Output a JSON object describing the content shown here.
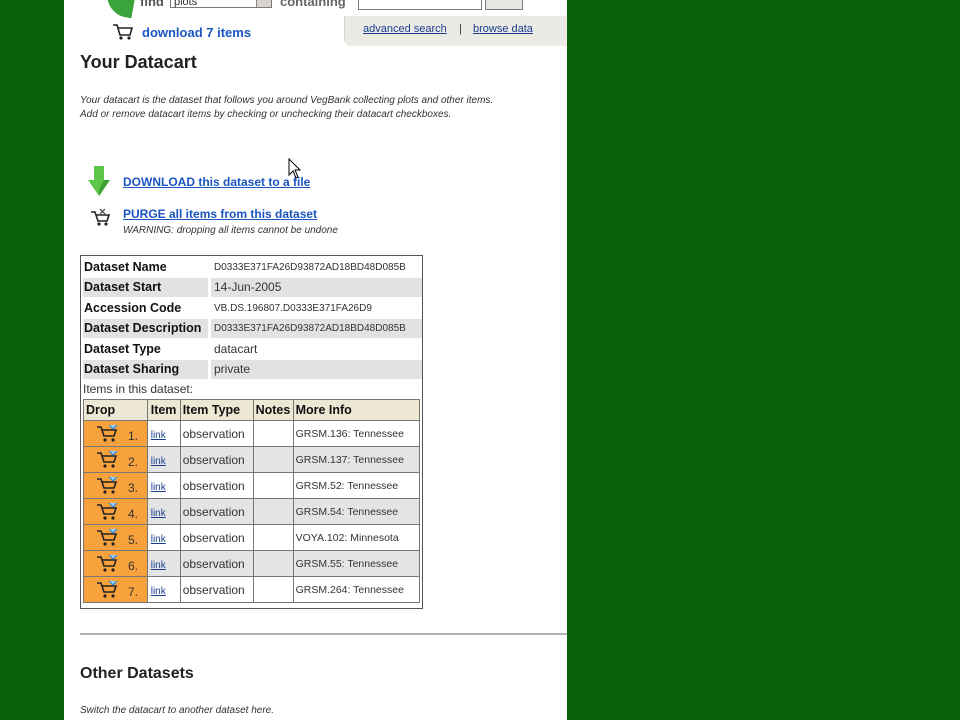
{
  "topbar": {
    "find_label": "find",
    "find_value": "plots",
    "containing_label": "containing",
    "advanced_search": "advanced search",
    "separator": "|",
    "browse_data": "browse data",
    "download_items": "download 7 items"
  },
  "page": {
    "title": "Your Datacart",
    "intro_line1": "Your datacart is the dataset that follows you around VegBank collecting plots and other items.",
    "intro_line2": "Add or remove datacart items by checking or unchecking their datacart checkboxes.",
    "download_link": "DOWNLOAD this dataset to a file",
    "purge_link": "PURGE all items from this dataset",
    "purge_warning": "WARNING: dropping all items cannot be undone"
  },
  "dataset": {
    "rows": [
      {
        "label": "Dataset Name",
        "value": "D0333E371FA26D93872AD18BD48D085B"
      },
      {
        "label": "Dataset Start",
        "value": "14-Jun-2005"
      },
      {
        "label": "Accession Code",
        "value": "VB.DS.196807.D0333E371FA26D9"
      },
      {
        "label": "Dataset Description",
        "value": "D0333E371FA26D93872AD18BD48D085B"
      },
      {
        "label": "Dataset Type",
        "value": "datacart"
      },
      {
        "label": "Dataset Sharing",
        "value": "private"
      }
    ],
    "items_label": "Items in this dataset:"
  },
  "items_table": {
    "headers": [
      "Drop",
      "Item",
      "Item Type",
      "Notes",
      "More Info"
    ],
    "rows": [
      {
        "num": "1.",
        "link": "link",
        "type": "observation",
        "notes": "",
        "more": "GRSM.136: Tennessee"
      },
      {
        "num": "2.",
        "link": "link",
        "type": "observation",
        "notes": "",
        "more": "GRSM.137: Tennessee"
      },
      {
        "num": "3.",
        "link": "link",
        "type": "observation",
        "notes": "",
        "more": "GRSM.52: Tennessee"
      },
      {
        "num": "4.",
        "link": "link",
        "type": "observation",
        "notes": "",
        "more": "GRSM.54: Tennessee"
      },
      {
        "num": "5.",
        "link": "link",
        "type": "observation",
        "notes": "",
        "more": "VOYA.102: Minnesota"
      },
      {
        "num": "6.",
        "link": "link",
        "type": "observation",
        "notes": "",
        "more": "GRSM.55: Tennessee"
      },
      {
        "num": "7.",
        "link": "link",
        "type": "observation",
        "notes": "",
        "more": "GRSM.264: Tennessee"
      }
    ]
  },
  "other": {
    "title": "Other Datasets",
    "switch_text": "Switch the datacart to another dataset here."
  },
  "colors": {
    "background": "#0a5f0a",
    "link": "#1a55c0",
    "drop_cell": "#f7a23c",
    "header_cell": "#ede8d4",
    "shade": "#e2e2e2"
  },
  "icons": [
    "cart-icon",
    "download-arrow-icon",
    "purge-cart-icon",
    "mouse-cursor-icon",
    "drop-cart-icon"
  ]
}
